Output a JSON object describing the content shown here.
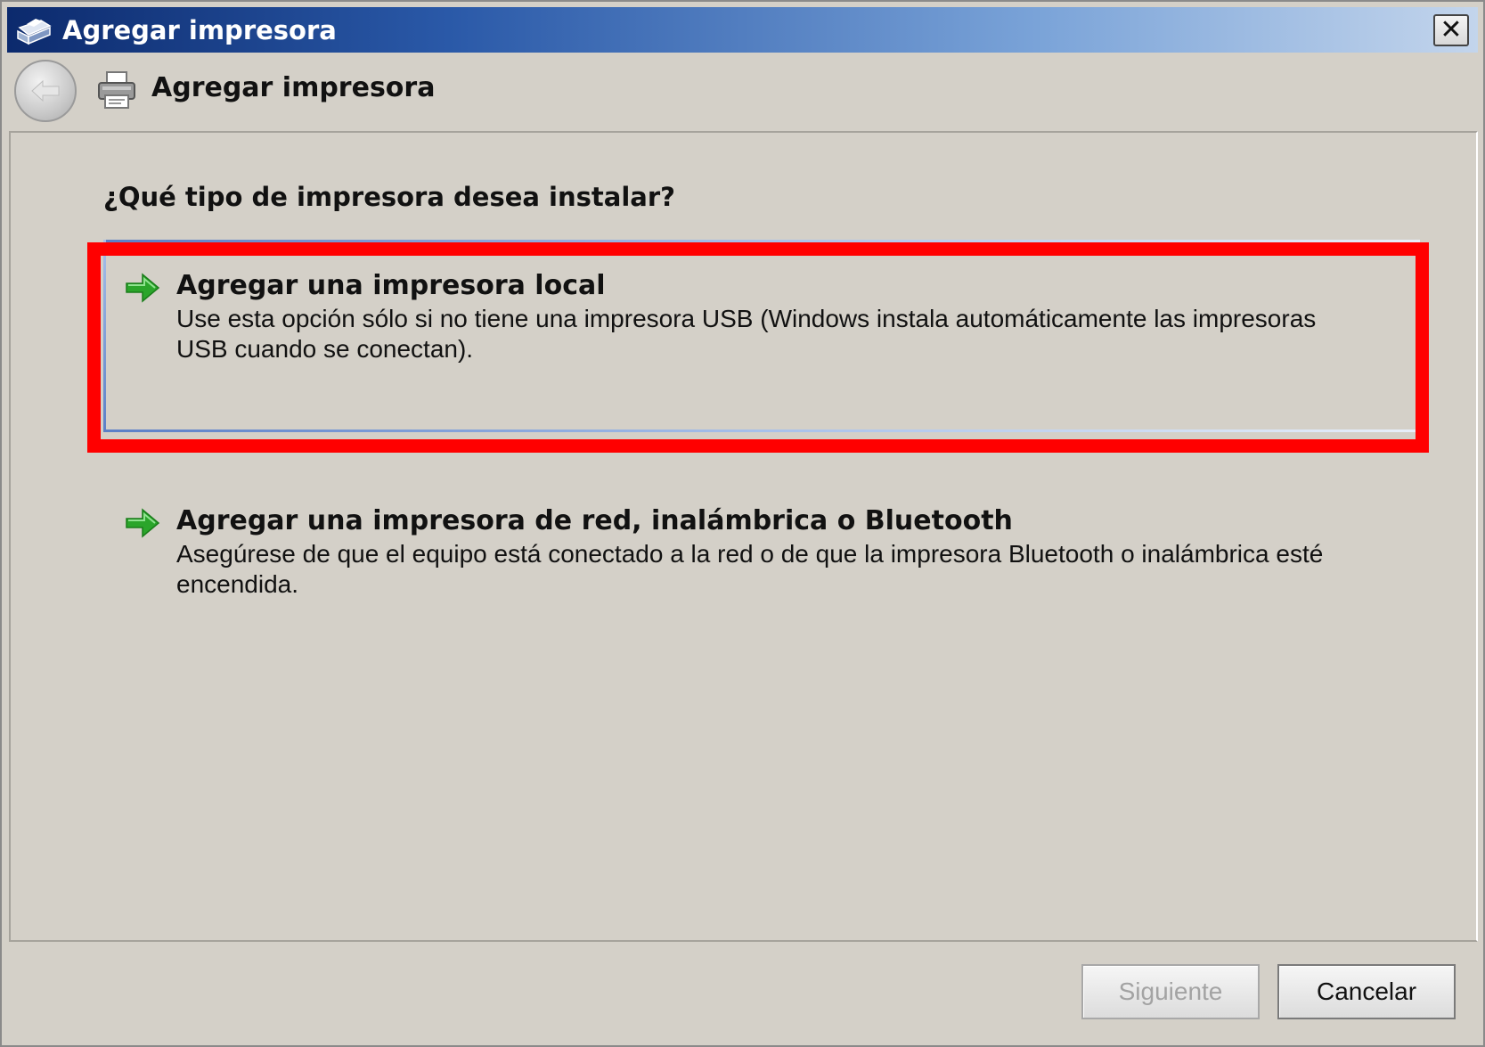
{
  "window": {
    "title": "Agregar impresora",
    "close_label": "✕"
  },
  "header": {
    "title": "Agregar impresora"
  },
  "content": {
    "question": "¿Qué tipo de impresora desea instalar?",
    "options": [
      {
        "title": "Agregar una impresora local",
        "description": "Use esta opción sólo si no tiene una impresora USB (Windows instala automáticamente las impresoras USB cuando se conectan).",
        "highlighted": true
      },
      {
        "title": "Agregar una impresora de red, inalámbrica o Bluetooth",
        "description": "Asegúrese de que el equipo está conectado a la red o de que la impresora Bluetooth o inalámbrica esté encendida.",
        "highlighted": false
      }
    ]
  },
  "footer": {
    "next_label": "Siguiente",
    "cancel_label": "Cancelar",
    "next_enabled": false
  },
  "colors": {
    "annotation_box": "#ff0000",
    "arrow_green": "#2aa52a",
    "dialog_bg": "#d4d0c8",
    "titlebar_start": "#0c2a6d"
  },
  "icons": {
    "title": "printer-icon",
    "back": "back-arrow-icon",
    "header": "printer-icon",
    "option": "green-arrow-icon"
  }
}
